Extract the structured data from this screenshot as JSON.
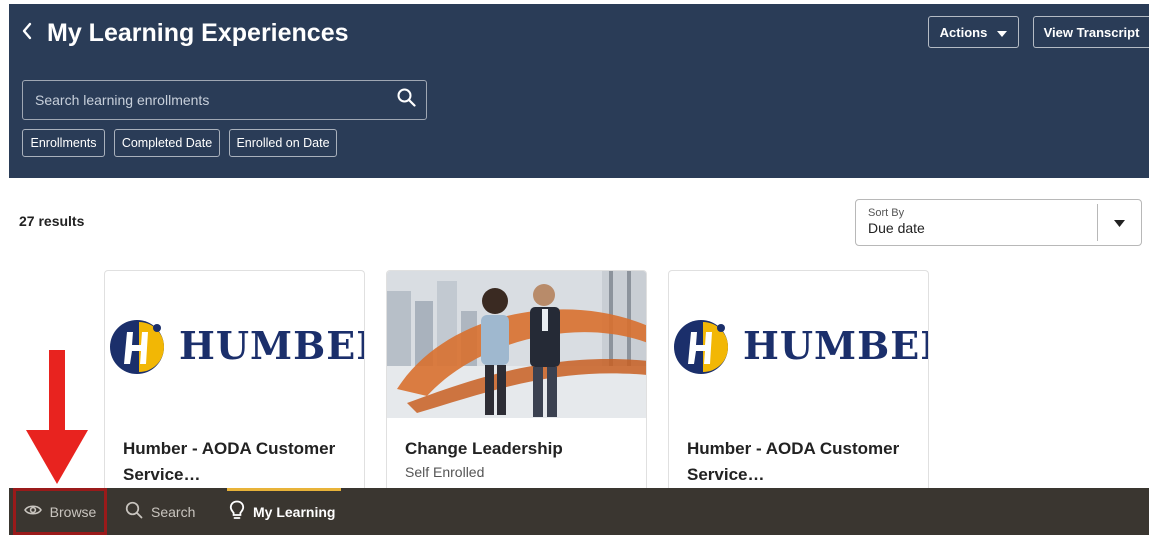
{
  "header": {
    "title": "My Learning Experiences",
    "actions_label": "Actions",
    "transcript_label": "View Transcript",
    "search": {
      "placeholder": "Search learning enrollments",
      "value": ""
    },
    "filters": [
      "Enrollments",
      "Completed Date",
      "Enrolled on Date"
    ]
  },
  "results": {
    "count_text": "27 results",
    "sort": {
      "label": "Sort By",
      "value": "Due date"
    }
  },
  "cards": [
    {
      "logo_text": "HUMBER",
      "title": "Humber - AODA Customer Service…",
      "subtitle": ""
    },
    {
      "logo_text": "",
      "title": "Change Leadership",
      "subtitle": "Self Enrolled"
    },
    {
      "logo_text": "HUMBER",
      "title": "Humber - AODA Customer Service…",
      "subtitle": ""
    }
  ],
  "bottom_nav": {
    "items": [
      {
        "label": "Browse",
        "icon": "eye-icon"
      },
      {
        "label": "Search",
        "icon": "search-icon"
      },
      {
        "label": "My Learning",
        "icon": "lightbulb-icon",
        "active": true
      }
    ]
  },
  "colors": {
    "header_bg": "#2a3c57",
    "nav_bg": "#3a3630",
    "nav_active_indicator": "#e8b339",
    "annotation_red": "#e8231f",
    "humber_navy": "#1b2f6b",
    "humber_gold": "#f2b705"
  }
}
